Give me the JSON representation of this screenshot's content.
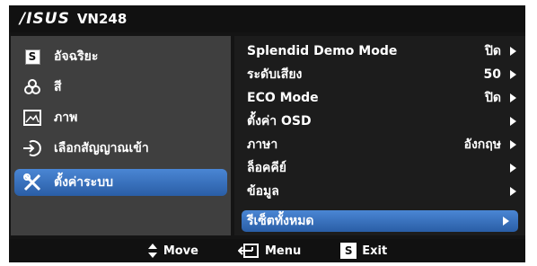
{
  "header": {
    "brand": "/ISUS",
    "model": "VN248"
  },
  "menu": [
    {
      "label": "อัจฉริยะ",
      "icon": "splendid-s-icon"
    },
    {
      "label": "สี",
      "icon": "color-icon"
    },
    {
      "label": "ภาพ",
      "icon": "image-icon"
    },
    {
      "label": "เลือกสัญญาณเข้า",
      "icon": "input-select-icon"
    },
    {
      "label": "ตั้งค่าระบบ",
      "icon": "wrench-tools-icon",
      "selected": true
    }
  ],
  "settings": [
    {
      "label": "Splendid Demo Mode",
      "value": "ปิด"
    },
    {
      "label": "ระดับเสียง",
      "value": "50"
    },
    {
      "label": "ECO Mode",
      "value": "ปิด"
    },
    {
      "label": "ตั้งค่า OSD",
      "value": ""
    },
    {
      "label": "ภาษา",
      "value": "อังกฤษ"
    },
    {
      "label": "ล็อคคีย์",
      "value": ""
    },
    {
      "label": "ข้อมูล",
      "value": ""
    },
    {
      "label": "รีเซ็ตทั้งหมด",
      "value": "",
      "selected": true
    }
  ],
  "footer": {
    "move": "Move",
    "menu": "Menu",
    "exit": "Exit",
    "s_icon_letter": "S"
  },
  "colors": {
    "highlight": "#3a74c4",
    "panel_left": "#3f3f3f",
    "panel_right": "#1c1c1c"
  }
}
